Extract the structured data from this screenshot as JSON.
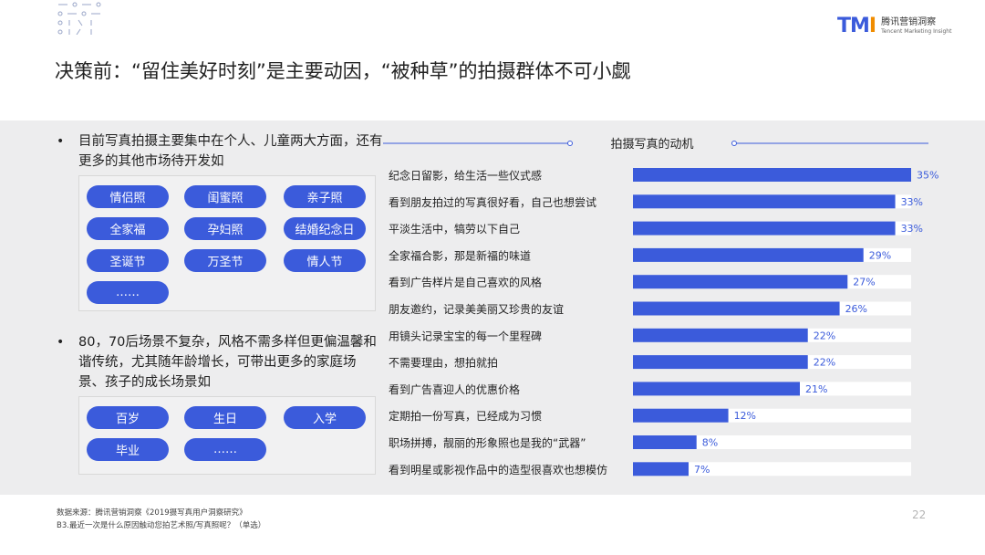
{
  "header": {
    "logo_mark": "TMI",
    "logo_cn": "腾讯营销洞察",
    "logo_en": "Tencent Marketing Insight",
    "title": "决策前：“留住美好时刻”是主要动因，“被种草”的拍摄群体不可小觑"
  },
  "left": {
    "bullet1": "目前写真拍摄主要集中在个人、儿童两大方面，还有更多的其他市场待开发如",
    "tags1": [
      "情侣照",
      "闺蜜照",
      "亲子照",
      "全家福",
      "孕妇照",
      "结婚纪念日",
      "圣诞节",
      "万圣节",
      "情人节",
      "……"
    ],
    "bullet2": "80，70后场景不复杂，风格不需多样但更偏温馨和谐传统，尤其随年龄增长，可带出更多的家庭场景、孩子的成长场景如",
    "tags2": [
      "百岁",
      "生日",
      "入学",
      "毕业",
      "……"
    ]
  },
  "chart_data": {
    "type": "bar",
    "orientation": "horizontal",
    "title": "拍摄写真的动机",
    "categories": [
      "纪念日留影，给生活一些仪式感",
      "看到朋友拍过的写真很好看，自己也想尝试",
      "平淡生活中，犒劳以下自己",
      "全家福合影，那是新福的味道",
      "看到广告样片是自己喜欢的风格",
      "朋友邀约，记录美美丽又珍贵的友谊",
      "用镜头记录宝宝的每一个里程碑",
      "不需要理由，想拍就拍",
      "看到广告喜迎人的优惠价格",
      "定期拍一份写真，已经成为习惯",
      "职场拼搏，靓丽的形象照也是我的“武器”",
      "看到明星或影视作品中的造型很喜欢也想模仿"
    ],
    "values": [
      35,
      33,
      33,
      29,
      27,
      26,
      22,
      22,
      21,
      12,
      8,
      7
    ],
    "value_labels": [
      "35%",
      "33%",
      "33%",
      "29%",
      "27%",
      "26%",
      "22%",
      "22%",
      "21%",
      "12%",
      "8%",
      "7%"
    ],
    "xlim": [
      0,
      35
    ],
    "bar_color": "#3b5bdb",
    "track_color": "#ffffff",
    "label_color": "#3b5bdb"
  },
  "footer": {
    "source": "数据来源：腾讯营销洞察《2019摄写真用户洞察研究》",
    "question": "B3.最近一次是什么原因触动您拍艺术照/写真照呢？（单选）",
    "page": "22"
  }
}
